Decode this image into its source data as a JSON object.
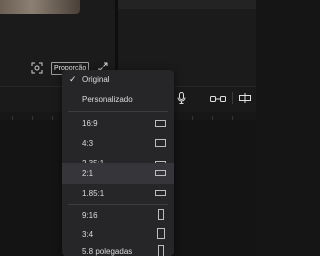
{
  "preview": {
    "ratio_button_label": "Proporção"
  },
  "aspect_menu": {
    "items": [
      {
        "label": "Original",
        "checked": true,
        "shape": "none"
      },
      {
        "label": "Personalizado",
        "shape": "none"
      },
      {
        "label": "16:9",
        "shape": "landscape"
      },
      {
        "label": "4:3",
        "shape": "landscape"
      },
      {
        "label": "2.35:1",
        "shape": "wide"
      },
      {
        "label": "2:1",
        "shape": "wide",
        "highlighted": true
      },
      {
        "label": "1.85:1",
        "shape": "landscape"
      },
      {
        "label": "9:16",
        "shape": "portrait"
      },
      {
        "label": "3:4",
        "shape": "portrait"
      },
      {
        "label": "5.8 polegadas",
        "shape": "portrait"
      }
    ]
  },
  "icons": {
    "crop": "crop-focus-icon",
    "fullscreen": "expand-icon",
    "microphone": "microphone-icon",
    "link": "link-icon",
    "split": "split-icon"
  },
  "colors": {
    "background": "#151515",
    "menu_bg": "#262628",
    "highlight": "#36363a"
  }
}
